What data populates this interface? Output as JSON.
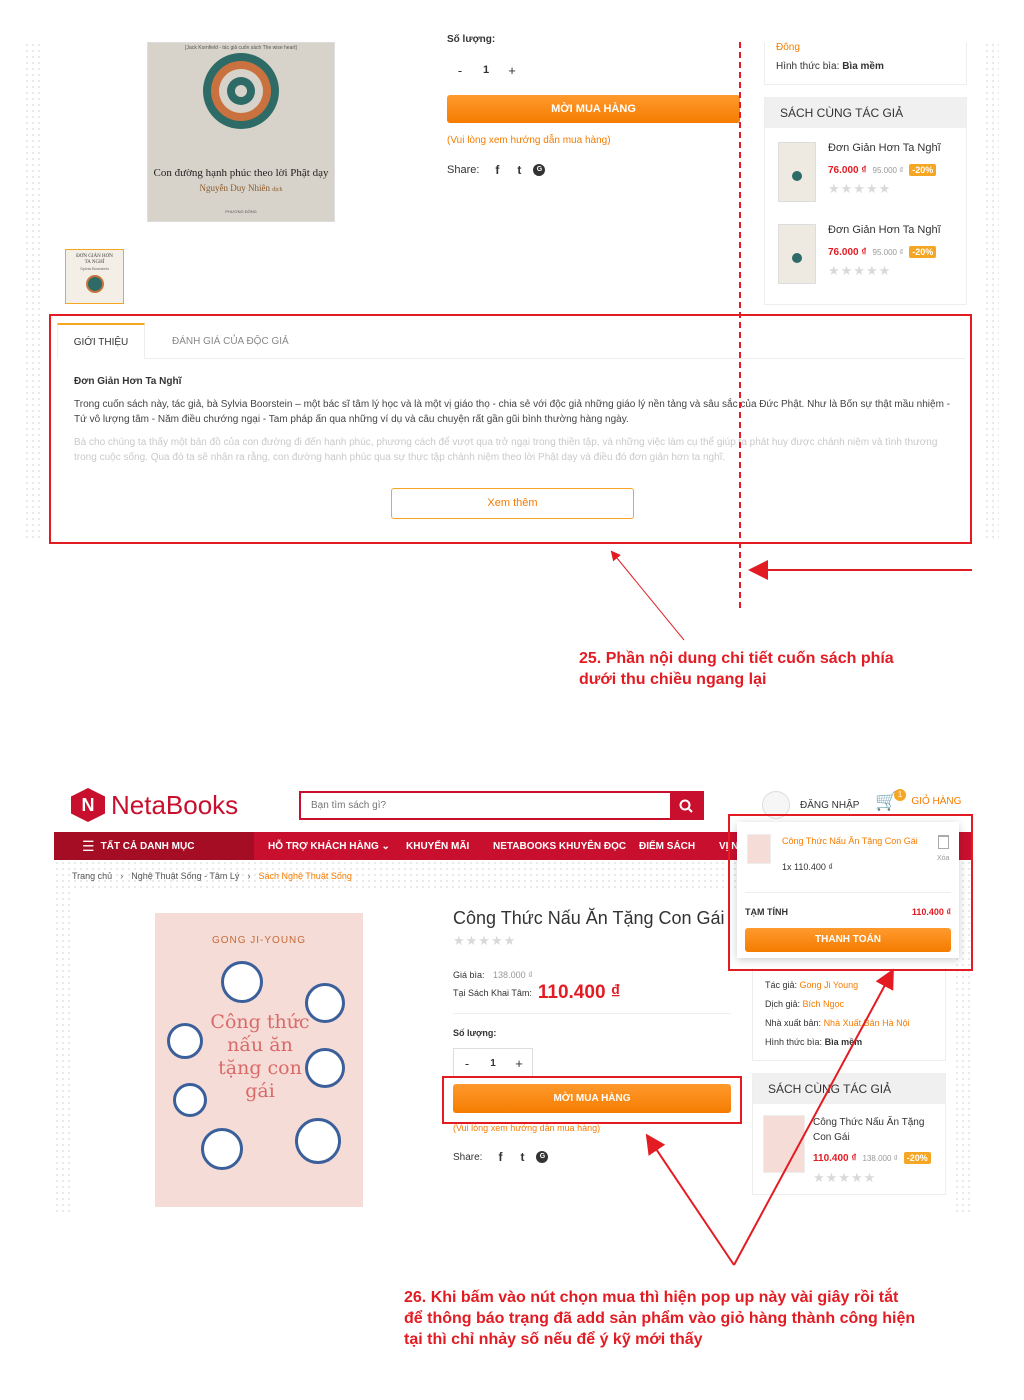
{
  "s1": {
    "cover1": {
      "top": "[Jack Kornfield - tác giả cuốn sách The wise heart]",
      "title": "Con đường hạnh phúc theo lời Phật dạy",
      "author": "Nguyễn Duy Nhiên",
      "author_role": "dịch",
      "publisher": "PHƯƠNG ĐÔNG"
    },
    "qty_label": "Số lượng:",
    "qty": {
      "minus": "-",
      "value": "1",
      "plus": "+"
    },
    "buy_button": "MỜI MUA HÀNG",
    "buy_note": "(Vui lòng xem hướng dẫn mua hàng)",
    "share_label": "Share:",
    "right_info": {
      "top": "Đông",
      "cover_label": "Hình thức bìa:",
      "cover_value": "Bìa mềm"
    },
    "same_author_title": "SÁCH CÙNG TÁC GIẢ",
    "same_author": [
      {
        "name": "Đơn Giản Hơn Ta Nghĩ",
        "price": "76.000 ₫",
        "old": "95.000 ₫",
        "discount": "-20%"
      },
      {
        "name": "Đơn Giản Hơn Ta Nghĩ",
        "price": "76.000 ₫",
        "old": "95.000 ₫",
        "discount": "-20%"
      }
    ],
    "thumb_text": {
      "title": "ĐƠN GIẢN HƠN TA NGHĨ",
      "author": "Sylvia Boorstein"
    },
    "tabs": {
      "intro": "GIỚI THIỆU",
      "reviews": "ĐÁNH GIÁ CỦA ĐỘC GIẢ"
    },
    "desc_title": "Đơn Giản Hơn Ta Nghĩ",
    "desc_p1": "Trong cuốn sách này, tác giả, bà Sylvia Boorstein – một bác sĩ tâm lý học và là một vị giáo thọ - chia sẻ với độc giả những giáo lý nền tảng và sâu sắc của Đức Phật. Như là Bốn sự thật mầu nhiệm - Tứ vô lượng tâm - Năm điều chướng ngại - Tam pháp ấn qua những ví dụ và câu chuyện rất gần gũi bình thường hàng ngày.",
    "desc_p2": "Bà cho chúng ta thấy một bản đồ của con đường đi đến hạnh phúc, phương cách để vượt qua trở ngại trong thiền tập, và những việc làm cụ thể giúp ta phát huy được chánh niệm và tình thương trong cuộc sống. Qua đó ta sẽ nhận ra rằng, con đường hạnh phúc qua sự thực tập chánh niệm theo lời Phật dạy và điều đó đơn giản hơn ta nghĩ.",
    "more_button": "Xem thêm",
    "annotation": "25. Phần nội dung chi tiết cuốn sách phía\ndưới thu chiều ngang lại"
  },
  "s2": {
    "logo": {
      "a": "Neta",
      "b": "Books"
    },
    "search_placeholder": "Bạn tìm sách gì?",
    "login": "ĐĂNG NHẬP",
    "cart": "GIỎ HÀNG",
    "cart_count": "1",
    "nav": [
      "TẤT CẢ DANH MỤC",
      "HỖ TRỢ KHÁCH HÀNG",
      "KHUYẾN MÃI",
      "NETABOOKS KHUYÊN ĐỌC",
      "ĐIỂM SÁCH",
      "VỊ NETA"
    ],
    "breadcrumb": [
      "Trang chủ",
      "Nghệ Thuật Sống - Tâm Lý",
      "Sách Nghệ Thuật Sống"
    ],
    "cover2": {
      "author": "GONG JI-YOUNG",
      "title": "Công thức nấu ăn tặng con gái"
    },
    "title": "Công Thức Nấu Ăn Tặng Con Gái",
    "price_label": "Giá bìa:",
    "price_old": "138.000 ₫",
    "store_label": "Tại Sách Khai Tâm:",
    "price": "110.400 ₫",
    "qty_label": "Số lượng:",
    "qty": {
      "minus": "-",
      "value": "1",
      "plus": "+"
    },
    "buy_button": "MỜI MUA HÀNG",
    "buy_note": "(Vui lòng xem hướng dẫn mua hàng)",
    "share_label": "Share:",
    "info": [
      {
        "label": "Tác giả:",
        "value": "Gong Ji Young"
      },
      {
        "label": "Dịch giả:",
        "value": "Bích Ngọc"
      },
      {
        "label": "Nhà xuất bản:",
        "value": "Nhà Xuất Bản Hà Nội"
      },
      {
        "label": "Hình thức bìa:",
        "value": "Bìa mềm"
      }
    ],
    "same_author_title": "SÁCH CÙNG TÁC GIẢ",
    "same_author": {
      "name": "Công Thức Nấu Ăn Tặng Con Gái",
      "price": "110.400 ₫",
      "old": "138.000 ₫",
      "discount": "-20%"
    },
    "popup": {
      "item": "Công Thức Nấu Ăn Tặng Con Gái",
      "line": "1x 110.400 ₫",
      "remove": "Xóa",
      "subtotal_label": "TẠM TÍNH",
      "subtotal": "110.400 ₫",
      "checkout": "THANH TOÁN"
    },
    "annotation": "26. Khi bấm vào nút chọn mua thì hiện pop up này vài giây rồi tắt\nđể thông báo trạng đã add sản phẩm vào giỏ hàng thành công hiện\ntại thì chỉ nhảy số nếu để ý kỹ mới thấy"
  },
  "colors": {
    "brand_red": "#c8102e",
    "nav_bg": "#c8102e",
    "orange": "#f57c00",
    "annotation": "#e31b23"
  }
}
